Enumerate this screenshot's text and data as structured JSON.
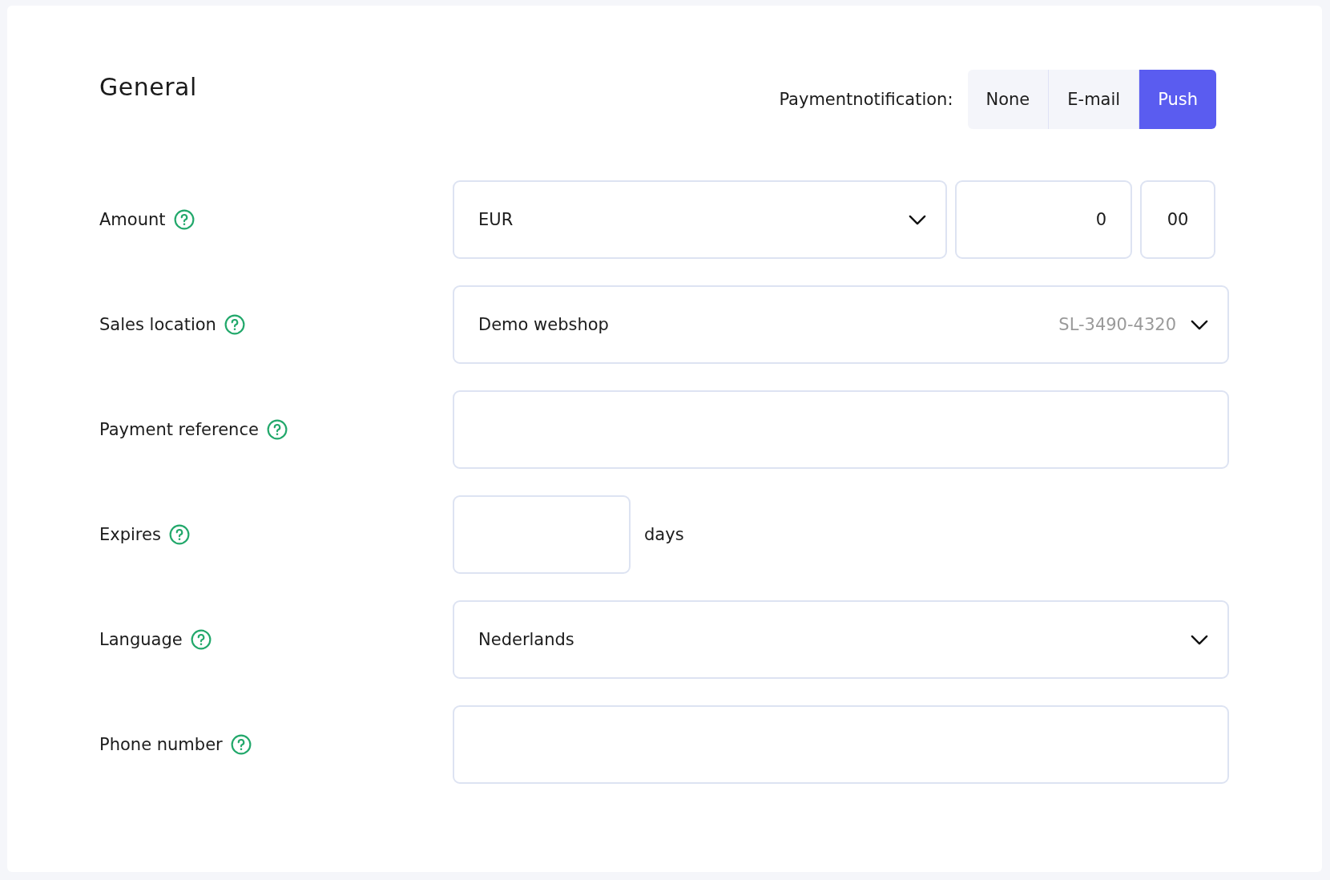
{
  "title": "General",
  "notification": {
    "label": "Paymentnotification:",
    "options": [
      {
        "label": "None",
        "selected": false
      },
      {
        "label": "E-mail",
        "selected": false
      },
      {
        "label": "Push",
        "selected": true
      }
    ]
  },
  "fields": [
    {
      "kind": "amount",
      "label": "Amount",
      "currency": "EUR",
      "whole": "0",
      "cents": "00"
    },
    {
      "kind": "select",
      "label": "Sales location",
      "value": "Demo webshop",
      "detail": "SL-3490-4320"
    },
    {
      "kind": "text",
      "label": "Payment reference"
    },
    {
      "kind": "days",
      "label": "Expires",
      "unit": "days"
    },
    {
      "kind": "select",
      "label": "Language",
      "value": "Nederlands"
    },
    {
      "kind": "text",
      "label": "Phone number"
    }
  ]
}
